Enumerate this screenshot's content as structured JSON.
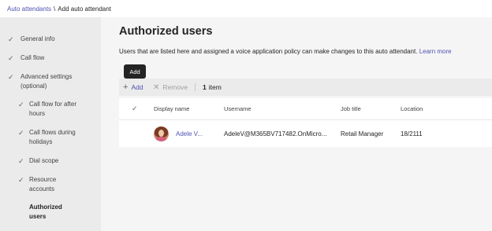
{
  "breadcrumb": {
    "parent": "Auto attendants",
    "separator": "\\",
    "current": "Add auto attendant"
  },
  "sidebar": {
    "steps": [
      {
        "label": "General info",
        "completed": true
      },
      {
        "label": "Call flow",
        "completed": true
      },
      {
        "label_line1": "Advanced settings",
        "label_line2": "(optional)",
        "completed": true
      },
      {
        "label_line1": "Call flow for after",
        "label_line2": "hours",
        "completed": true
      },
      {
        "label_line1": "Call flows during",
        "label_line2": "holidays",
        "completed": true
      },
      {
        "label": "Dial scope",
        "completed": true
      },
      {
        "label_line1": "Resource",
        "label_line2": "accounts",
        "completed": true
      },
      {
        "label_line1": "Authorized",
        "label_line2": "users",
        "completed": false,
        "active": true
      }
    ],
    "check_glyph": "✓"
  },
  "main": {
    "title": "Authorized users",
    "description": "Users that are listed here and assigned a voice application policy can make changes to this auto attendant.",
    "learn_more": "Learn more"
  },
  "tooltip": {
    "text": "Add"
  },
  "toolbar": {
    "add_icon": "+",
    "add_label": "Add",
    "remove_icon": "✕",
    "remove_label": "Remove",
    "separator": "|",
    "count": "1",
    "count_label": "item"
  },
  "table": {
    "check_glyph": "✓",
    "columns": {
      "display_name": "Display name",
      "username": "Username",
      "job_title": "Job title",
      "location": "Location"
    },
    "rows": [
      {
        "display_name": "Adele V...",
        "username": "AdeleV@M365BV717482.OnMicro...",
        "job_title": "Retail Manager",
        "location": "18/2111"
      }
    ]
  },
  "colors": {
    "accent": "#4f52b2",
    "sidebar_bg": "#ebebeb",
    "main_bg": "#f5f5f5",
    "tooltip_bg": "#242424"
  }
}
